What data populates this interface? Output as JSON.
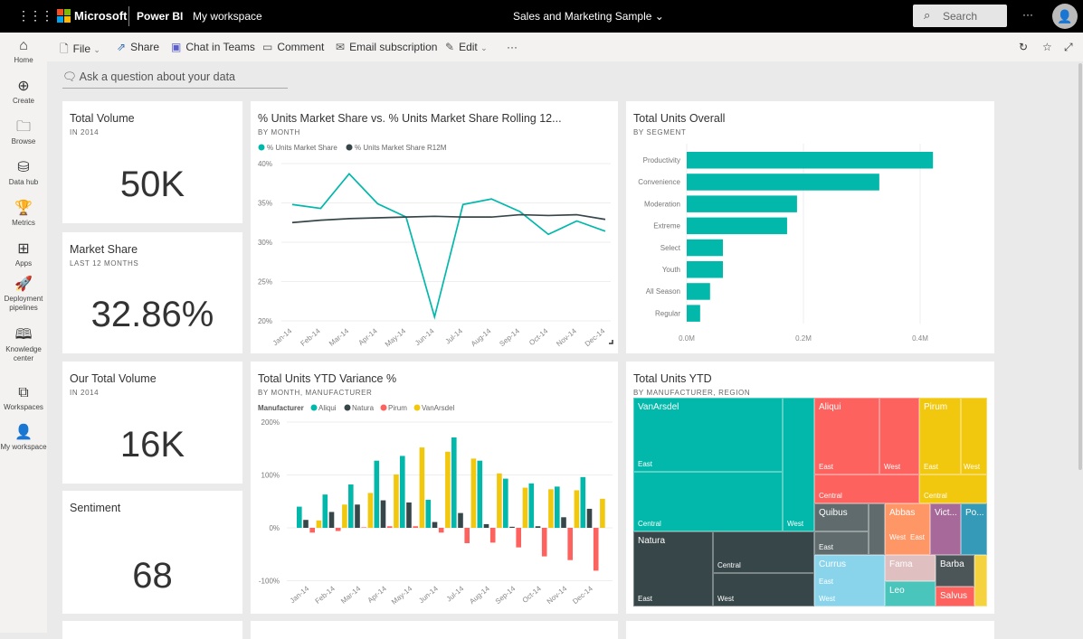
{
  "topbar": {
    "app_brand": "Microsoft",
    "product": "Power BI",
    "workspace": "My workspace",
    "report_title": "Sales and Marketing Sample",
    "search_placeholder": "Search",
    "more": "···"
  },
  "sidebar": [
    {
      "label": "Home",
      "icon": "home-icon",
      "glyph": "⌂"
    },
    {
      "label": "Create",
      "icon": "plus-circle-icon",
      "glyph": "⊕"
    },
    {
      "label": "Browse",
      "icon": "folder-icon",
      "glyph": "🗀"
    },
    {
      "label": "Data hub",
      "icon": "data-hub-icon",
      "glyph": "⛁"
    },
    {
      "label": "Metrics",
      "icon": "trophy-icon",
      "glyph": "🏆"
    },
    {
      "label": "Apps",
      "icon": "apps-icon",
      "glyph": "⊞"
    },
    {
      "label": "Deployment pipelines",
      "icon": "rocket-icon",
      "glyph": "🚀"
    },
    {
      "label": "Knowledge center",
      "icon": "book-icon",
      "glyph": "🕮"
    },
    {
      "label": "Workspaces",
      "icon": "workspaces-icon",
      "glyph": "⧉"
    },
    {
      "label": "My workspace",
      "icon": "user-icon",
      "glyph": "👤"
    }
  ],
  "toolbar": {
    "file": "File",
    "share": "Share",
    "chat": "Chat in Teams",
    "comment": "Comment",
    "email": "Email subscription",
    "edit": "Edit",
    "more": "···"
  },
  "qa": {
    "placeholder": "Ask a question about your data"
  },
  "cards": [
    {
      "title": "Total Volume",
      "subtitle": "IN 2014",
      "value": "50K"
    },
    {
      "title": "Market Share",
      "subtitle": "LAST 12 MONTHS",
      "value": "32.86%"
    },
    {
      "title": "Our Total Volume",
      "subtitle": "IN 2014",
      "value": "16K"
    },
    {
      "title": "Sentiment",
      "subtitle": "",
      "value": "68"
    }
  ],
  "colors": {
    "teal": "#01b8aa",
    "dark": "#374649",
    "red": "#fd625e",
    "yellow": "#f2c80f"
  },
  "chart_data": [
    {
      "type": "line",
      "title": "% Units Market Share vs. % Units Market Share Rolling 12...",
      "subtitle": "BY MONTH",
      "categories": [
        "Jan-14",
        "Feb-14",
        "Mar-14",
        "Apr-14",
        "May-14",
        "Jun-14",
        "Jul-14",
        "Aug-14",
        "Sep-14",
        "Oct-14",
        "Nov-14",
        "Dec-14"
      ],
      "yticks": [
        "20%",
        "25%",
        "30%",
        "35%",
        "40%"
      ],
      "ylim": [
        20,
        40
      ],
      "grid": true,
      "legend": "top-left",
      "series": [
        {
          "name": "% Units Market Share",
          "color": "#01b8aa",
          "values": [
            34.8,
            34.3,
            38.7,
            34.9,
            33.2,
            20.5,
            34.8,
            35.5,
            33.9,
            31.0,
            32.7,
            31.4
          ]
        },
        {
          "name": "% Units Market Share R12M",
          "color": "#374649",
          "values": [
            32.5,
            32.8,
            33.0,
            33.1,
            33.2,
            33.3,
            33.2,
            33.2,
            33.5,
            33.4,
            33.5,
            32.9
          ]
        }
      ]
    },
    {
      "type": "bar",
      "title": "Total Units Overall",
      "subtitle": "BY SEGMENT",
      "categories": [
        "Productivity",
        "Convenience",
        "Moderation",
        "Extreme",
        "Select",
        "Youth",
        "All Season",
        "Regular"
      ],
      "values": [
        0.422,
        0.33,
        0.189,
        0.172,
        0.062,
        0.062,
        0.04,
        0.023
      ],
      "unit": "M",
      "xticks": [
        "0.0M",
        "0.2M",
        "0.4M"
      ],
      "xlim": [
        0,
        0.5
      ],
      "color": "#01b8aa",
      "grid": true
    },
    {
      "type": "bar",
      "title": "Total Units YTD Variance %",
      "subtitle": "BY MONTH, MANUFACTURER",
      "legend_title": "Manufacturer",
      "legend": "top-left",
      "categories": [
        "Jan-14",
        "Feb-14",
        "Mar-14",
        "Apr-14",
        "May-14",
        "Jun-14",
        "Jul-14",
        "Aug-14",
        "Sep-14",
        "Oct-14",
        "Nov-14",
        "Dec-14"
      ],
      "yticks": [
        "-100%",
        "0%",
        "100%",
        "200%"
      ],
      "ylim": [
        -100,
        200
      ],
      "grid": true,
      "series": [
        {
          "name": "Aliqui",
          "color": "#01b8aa",
          "values": [
            40,
            63,
            82,
            127,
            136,
            53,
            171,
            127,
            93,
            84,
            78,
            96
          ]
        },
        {
          "name": "Natura",
          "color": "#374649",
          "values": [
            15,
            30,
            44,
            52,
            48,
            11,
            28,
            7,
            2,
            3,
            20,
            36
          ]
        },
        {
          "name": "Pirum",
          "color": "#fd625e",
          "values": [
            -9,
            -6,
            1,
            3,
            3,
            -9,
            -29,
            -28,
            -37,
            -54,
            -61,
            -81
          ]
        },
        {
          "name": "VanArsdel",
          "color": "#f2c80f",
          "values": [
            14,
            44,
            66,
            101,
            152,
            144,
            131,
            103,
            76,
            73,
            71,
            55
          ]
        }
      ]
    },
    {
      "type": "treemap",
      "title": "Total Units YTD",
      "subtitle": "BY MANUFACTURER, REGION",
      "labels": {
        "vanarsdel": "VanArsdel",
        "natura": "Natura",
        "aliqui": "Aliqui",
        "pirum": "Pirum",
        "quibus": "Quibus",
        "abbas": "Abbas",
        "vict": "Vict...",
        "po": "Po...",
        "currus": "Currus",
        "fama": "Fama",
        "leo": "Leo",
        "barba": "Barba",
        "salvus": "Salvus",
        "east": "East",
        "west": "West",
        "central": "Central"
      }
    }
  ]
}
